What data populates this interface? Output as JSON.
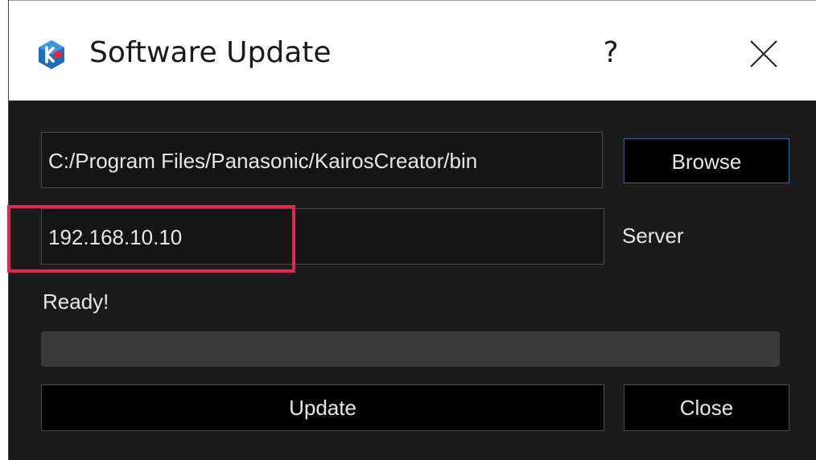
{
  "window": {
    "title": "Software Update",
    "help_label": "?",
    "icon": "kairos-app-icon",
    "close_icon": "close-icon"
  },
  "form": {
    "install_path": "C:/Program Files/Panasonic/KairosCreator/bin",
    "browse_label": "Browse",
    "server_address": "192.168.10.10",
    "server_label": "Server",
    "status": "Ready!",
    "progress": 0,
    "update_label": "Update",
    "close_label": "Close"
  },
  "colors": {
    "background": "#1b1b1b",
    "highlight": "#e3264c",
    "browse_border": "#2a6a9f"
  }
}
